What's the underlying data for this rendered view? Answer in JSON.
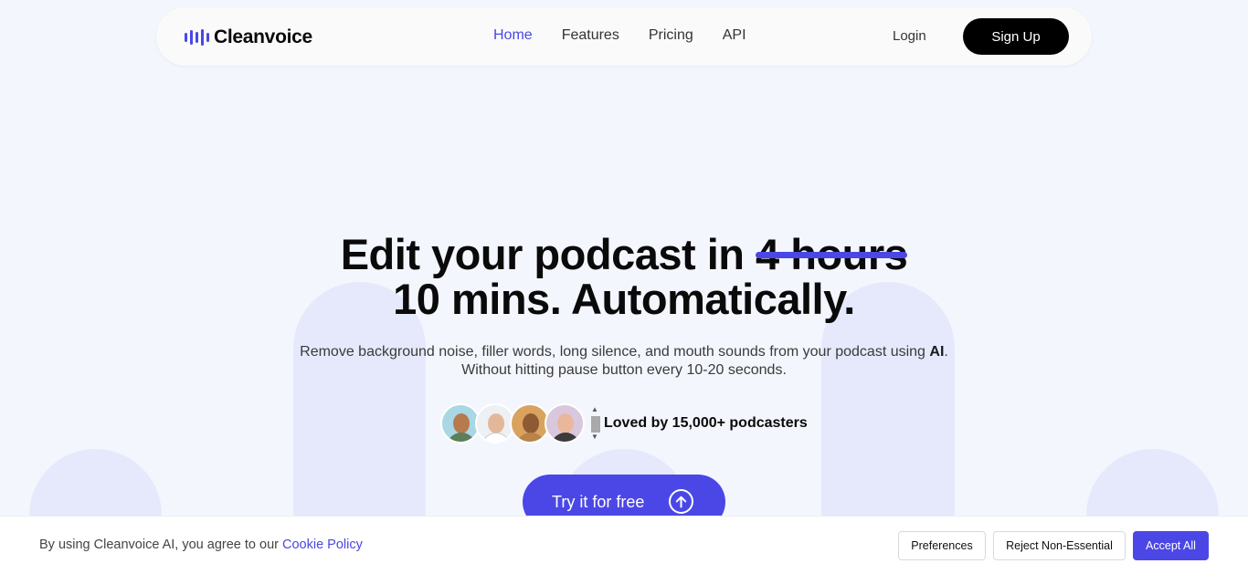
{
  "colors": {
    "accent": "#4b47e6",
    "background": "#f4f6fe",
    "arch": "#e6e9fb"
  },
  "brand": {
    "name": "Cleanvoice",
    "logo_icon": "audio-bars-icon"
  },
  "nav": {
    "links": [
      {
        "label": "Home",
        "active": true
      },
      {
        "label": "Features",
        "active": false
      },
      {
        "label": "Pricing",
        "active": false
      },
      {
        "label": "API",
        "active": false
      }
    ],
    "login": "Login",
    "signup": "Sign Up"
  },
  "hero": {
    "headline_prefix": "Edit your podcast in",
    "headline_struck": "4 hours",
    "headline_line2": "10 mins. Automatically.",
    "sub_line1": "Remove background noise, filler words, long silence, and mouth sounds from your podcast using",
    "sub_line1_bold": "AI",
    "sub_line1_end": ".",
    "sub_line2": "Without hitting pause button every 10-20 seconds.",
    "social_proof": "Loved by 15,000+ podcasters",
    "cta": "Try it for free",
    "cta_icon": "arrow-up-circle-icon"
  },
  "cookie": {
    "text": "By using Cleanvoice AI, you agree to our",
    "link": "Cookie Policy",
    "preferences": "Preferences",
    "reject": "Reject Non-Essential",
    "accept": "Accept All"
  }
}
